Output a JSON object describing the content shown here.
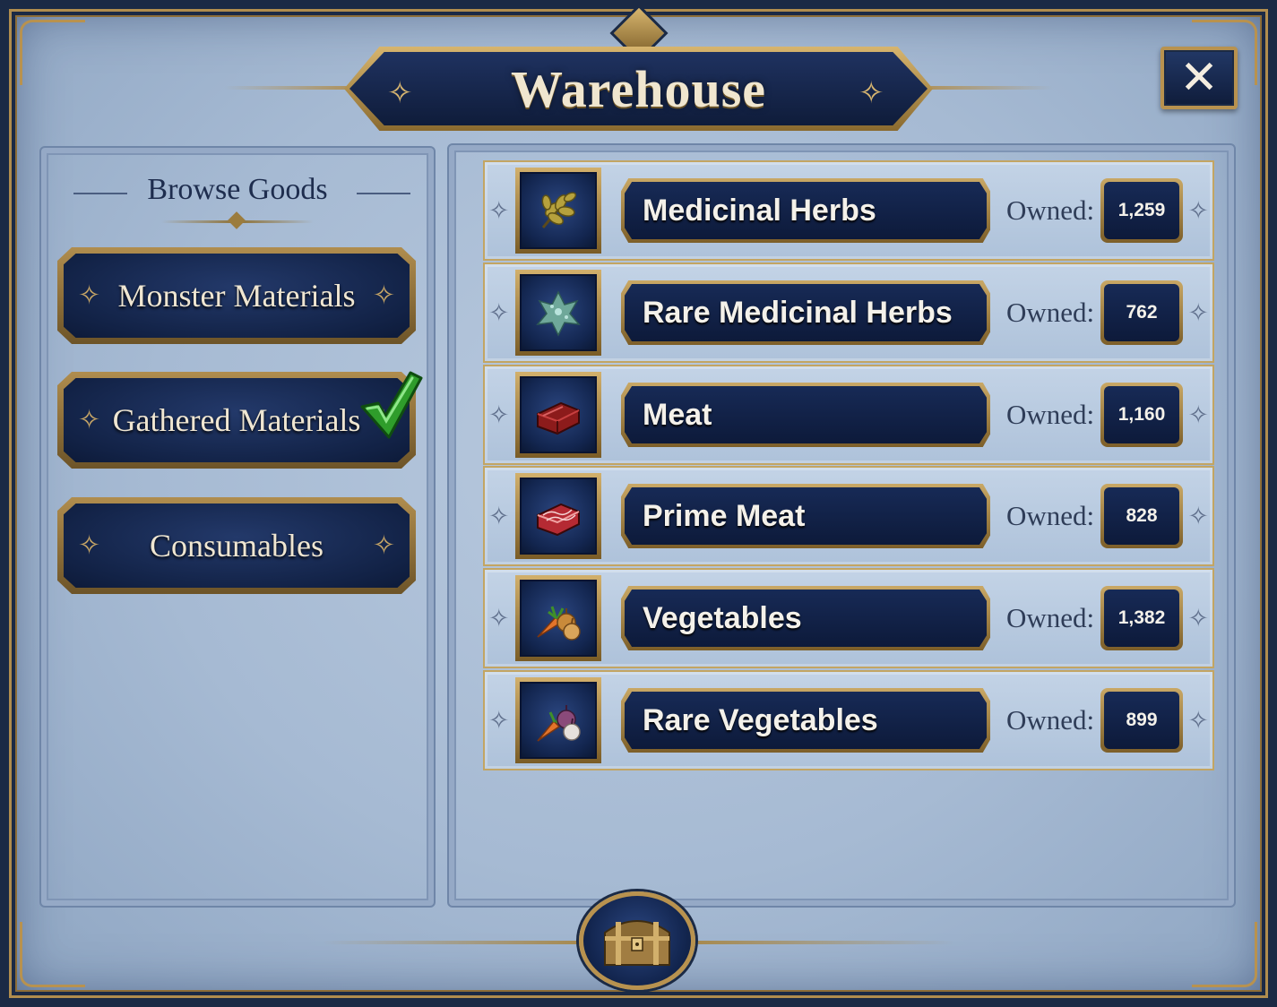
{
  "window": {
    "title": "Warehouse",
    "close_label": "✕",
    "colors": {
      "panel_bg": "#a6bad3",
      "navy": "#122246",
      "gold": "#b8924f",
      "text_light": "#f4f1ea",
      "check_green": "#3fbf3a"
    }
  },
  "sidebar": {
    "heading": "Browse Goods",
    "categories": [
      {
        "label": "Monster Materials",
        "selected": false
      },
      {
        "label": "Gathered Materials",
        "selected": true
      },
      {
        "label": "Consumables",
        "selected": false
      }
    ],
    "selected_icon": "checkmark-icon"
  },
  "items": {
    "owned_label": "Owned:",
    "list": [
      {
        "name": "Medicinal Herbs",
        "owned": "1,259",
        "icon": "herb-icon"
      },
      {
        "name": "Rare Medicinal Herbs",
        "owned": "762",
        "icon": "rare-herb-icon"
      },
      {
        "name": "Meat",
        "owned": "1,160",
        "icon": "meat-icon"
      },
      {
        "name": "Prime Meat",
        "owned": "828",
        "icon": "prime-meat-icon"
      },
      {
        "name": "Vegetables",
        "owned": "1,382",
        "icon": "vegetables-icon"
      },
      {
        "name": "Rare Vegetables",
        "owned": "899",
        "icon": "rare-vegetables-icon"
      }
    ]
  },
  "footer": {
    "icon": "treasure-chest-icon"
  }
}
